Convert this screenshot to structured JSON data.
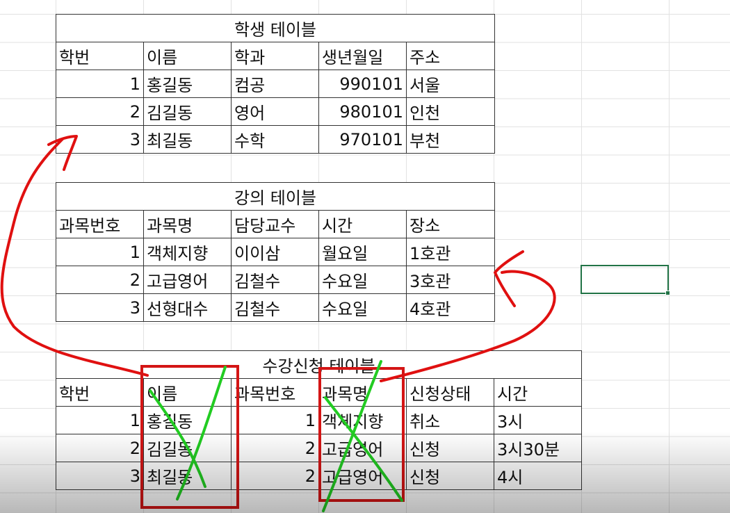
{
  "student_table": {
    "title": "학생 테이블",
    "headers": [
      "학번",
      "이름",
      "학과",
      "생년월일",
      "주소"
    ],
    "rows": [
      [
        "1",
        "홍길동",
        "컴공",
        "990101",
        "서울"
      ],
      [
        "2",
        "김길동",
        "영어",
        "980101",
        "인천"
      ],
      [
        "3",
        "최길동",
        "수학",
        "970101",
        "부천"
      ]
    ]
  },
  "course_table": {
    "title": "강의 테이블",
    "headers": [
      "과목번호",
      "과목명",
      "담당교수",
      "시간",
      "장소"
    ],
    "rows": [
      [
        "1",
        "객체지향",
        "이이삼",
        "월요일",
        "1호관"
      ],
      [
        "2",
        "고급영어",
        "김철수",
        "수요일",
        "3호관"
      ],
      [
        "3",
        "선형대수",
        "김철수",
        "수요일",
        "4호관"
      ]
    ]
  },
  "enroll_table": {
    "title": "수강신청 테이블",
    "headers": [
      "학번",
      "이름",
      "과목번호",
      "과목명",
      "신청상태",
      "시간"
    ],
    "rows": [
      [
        "1",
        "홍길동",
        "1",
        "객체지향",
        "취소",
        "3시"
      ],
      [
        "2",
        "김길동",
        "2",
        "고급영어",
        "신청",
        "3시30분"
      ],
      [
        "3",
        "최길동",
        "2",
        "고급영어",
        "신청",
        "4시"
      ]
    ]
  },
  "annotation_colors": {
    "arrow": "#e01010",
    "box": "#d41515",
    "cross": "#22cc22",
    "selection": "#217346"
  }
}
